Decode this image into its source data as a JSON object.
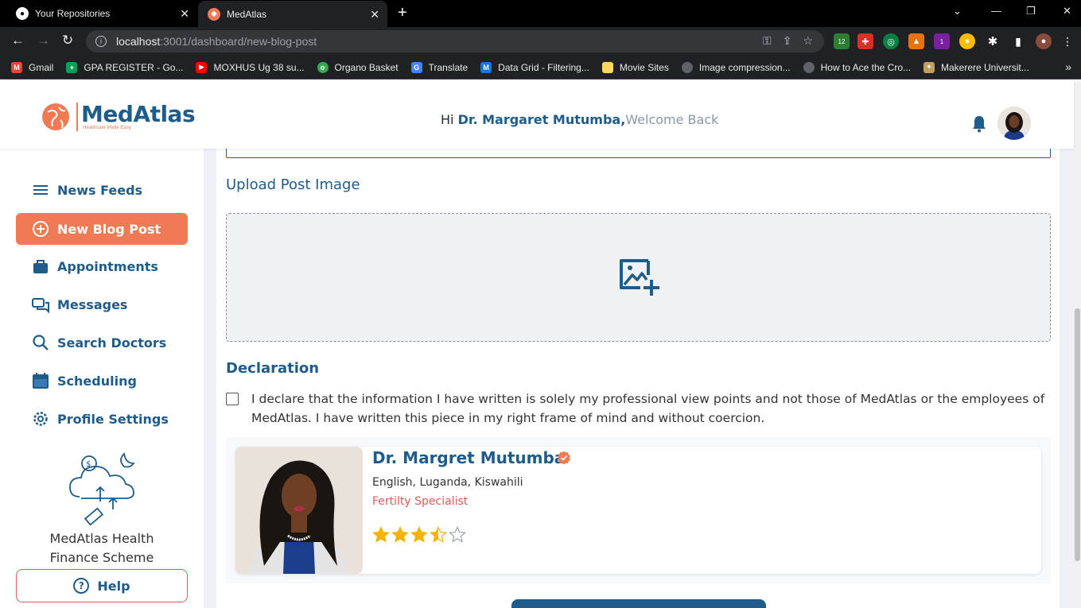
{
  "browser": {
    "tabs": [
      {
        "title": "Your Repositories",
        "active": false
      },
      {
        "title": "MedAtlas",
        "active": true
      }
    ],
    "url_host": "localhost",
    "url_rest": ":3001/dashboard/new-blog-post",
    "bookmarks": [
      {
        "label": "Gmail",
        "color": "#ea4335"
      },
      {
        "label": "GPA REGISTER - Go...",
        "color": "#0f9d58"
      },
      {
        "label": "MOXHUS Ug 38 su...",
        "color": "#ff0000"
      },
      {
        "label": "Organo Basket",
        "color": "#34a853"
      },
      {
        "label": "Translate",
        "color": "#4285f4"
      },
      {
        "label": "Data Grid - Filtering...",
        "color": "#1976d2"
      },
      {
        "label": "Movie Sites",
        "color": "#fdd663"
      },
      {
        "label": "Image compression...",
        "color": "#5f6368"
      },
      {
        "label": "How to Ace the Cro...",
        "color": "#5f6368"
      },
      {
        "label": "Makerere Universit...",
        "color": "#c0a060"
      }
    ],
    "extension_badges": [
      "12",
      "1"
    ]
  },
  "header": {
    "logo_text": "MedAtlas",
    "logo_tagline": "Healthcare Made Easy",
    "greeting_prefix": "Hi ",
    "greeting_name": "Dr. Margaret Mutumba,",
    "greeting_suffix": "Welcome Back"
  },
  "sidebar": {
    "items": [
      {
        "label": "News Feeds",
        "icon": "menu-icon",
        "active": false
      },
      {
        "label": "New Blog Post",
        "icon": "plus-circle-icon",
        "active": true
      },
      {
        "label": "Appointments",
        "icon": "briefcase-icon",
        "active": false
      },
      {
        "label": "Messages",
        "icon": "chat-icon",
        "active": false
      },
      {
        "label": "Search Doctors",
        "icon": "search-icon",
        "active": false
      },
      {
        "label": "Scheduling",
        "icon": "calendar-icon",
        "active": false
      },
      {
        "label": "Profile Settings",
        "icon": "gear-icon",
        "active": false
      }
    ],
    "finance_line1": "MedAtlas Health",
    "finance_line2": "Finance Scheme",
    "help_label": "Help"
  },
  "form": {
    "upload_label": "Upload Post Image",
    "declaration_title": "Declaration",
    "declaration_text": "I declare that the information I have written is solely my professional view points and not those of MedAtlas or the employees of MedAtlas. I have written this piece in my right frame of mind and without coercion.",
    "declaration_checked": false
  },
  "doctor": {
    "name": "Dr. Margret Mutumba",
    "languages": "English, Luganda, Kiswahili",
    "specialty": "Fertilty Specialist",
    "rating": 3.5,
    "rating_max": 5
  },
  "colors": {
    "brand_blue": "#1e5c8c",
    "accent_orange": "#f07a54",
    "star_gold": "#f5b301"
  }
}
